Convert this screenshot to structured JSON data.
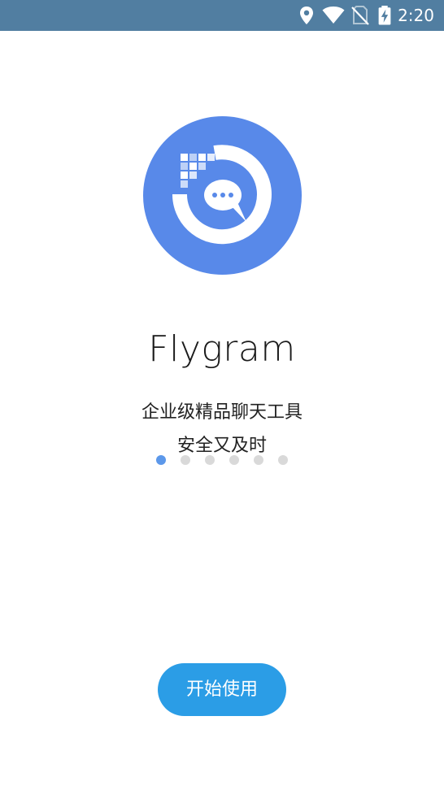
{
  "status_bar": {
    "time": "2:20",
    "icons": [
      "location-icon",
      "wifi-icon",
      "no-sim-icon",
      "battery-charging-icon"
    ]
  },
  "logo": {
    "icon": "chat-bubble-logo-icon",
    "color": "#5889e9"
  },
  "app": {
    "name": "Flygram",
    "tagline_line1": "企业级精品聊天工具",
    "tagline_line2": "安全又及时"
  },
  "pager": {
    "count": 6,
    "active_index": 0
  },
  "actions": {
    "start_label": "开始使用"
  },
  "colors": {
    "status_bar": "#517ea1",
    "accent": "#2b9de6",
    "dot_active": "#5c98ea",
    "dot_inactive": "#d9d9d9"
  }
}
